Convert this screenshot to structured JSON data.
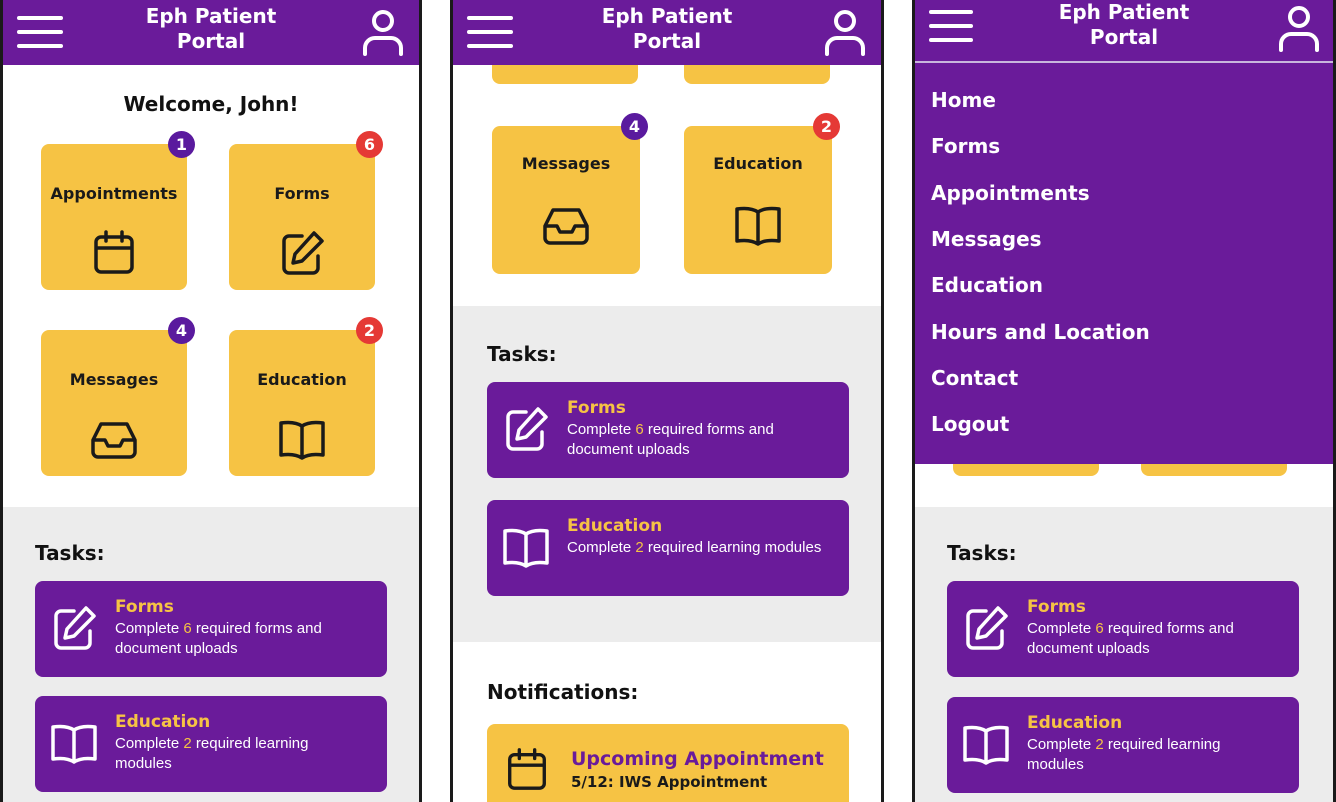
{
  "app": {
    "title_line1": "Eph Patient",
    "title_line2": "Portal"
  },
  "colors": {
    "primary": "#6a1b9a",
    "accent": "#f6c344",
    "badge_purple": "#5a1a9e",
    "badge_red": "#e53935",
    "section_bg": "#ececec"
  },
  "home": {
    "welcome": "Welcome, John!",
    "tiles": [
      {
        "label": "Appointments",
        "badge": "1",
        "icon": "calendar-icon"
      },
      {
        "label": "Forms",
        "badge": "6",
        "icon": "edit-icon"
      },
      {
        "label": "Messages",
        "badge": "4",
        "icon": "inbox-icon"
      },
      {
        "label": "Education",
        "badge": "2",
        "icon": "book-icon"
      }
    ]
  },
  "tasks": {
    "heading": "Tasks:",
    "items": [
      {
        "title": "Forms",
        "pre": "Complete ",
        "count": "6",
        "post": " required forms and document uploads",
        "icon": "edit-icon"
      },
      {
        "title": "Education",
        "pre": "Complete ",
        "count": "2",
        "post": " required learning modules",
        "icon": "book-icon"
      }
    ]
  },
  "notifications": {
    "heading": "Notifications:",
    "items": [
      {
        "title": "Upcoming Appointment",
        "detail": "5/12: IWS Appointment",
        "icon": "calendar-icon"
      }
    ]
  },
  "menu": {
    "items": [
      "Home",
      "Forms",
      "Appointments",
      "Messages",
      "Education",
      "Hours and Location",
      "Contact",
      "Logout"
    ]
  }
}
